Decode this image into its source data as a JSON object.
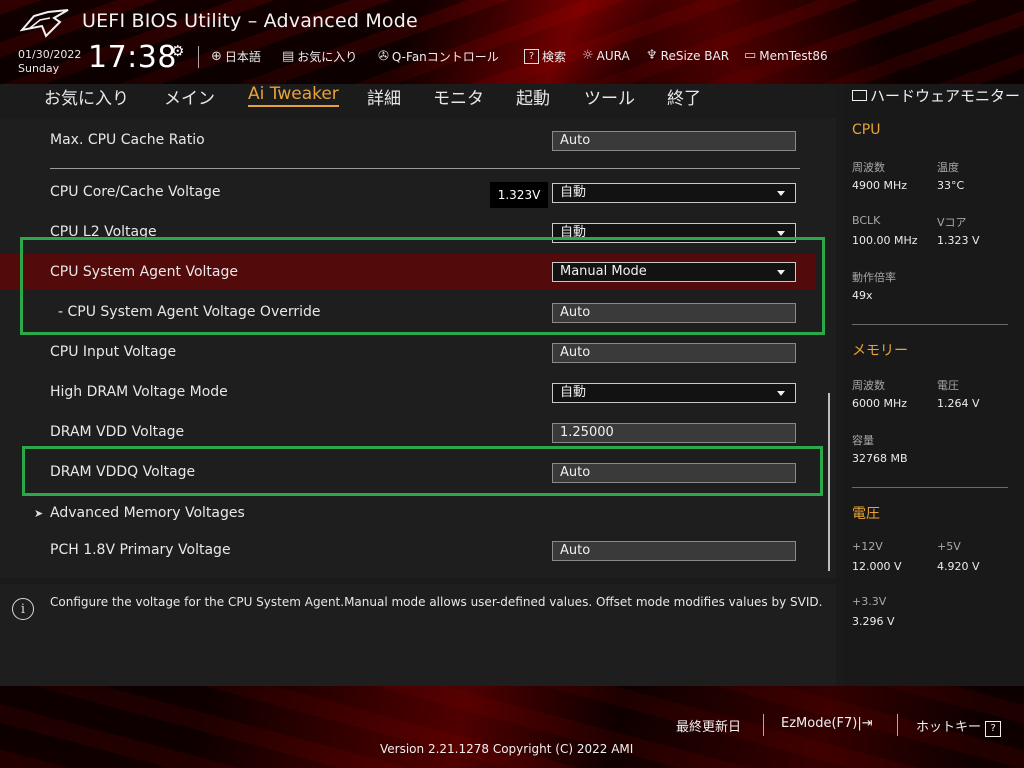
{
  "header": {
    "title": "UEFI BIOS Utility – Advanced Mode",
    "date": "01/30/2022",
    "day": "Sunday",
    "time": "17:38",
    "tools": [
      {
        "label": "日本語",
        "icon": "globe-icon"
      },
      {
        "label": "お気に入り",
        "icon": "favorites-icon"
      },
      {
        "label": "Q-Fanコントロール",
        "icon": "fan-icon"
      },
      {
        "label": "検索",
        "icon": "search-icon"
      },
      {
        "label": "AURA",
        "icon": "aura-icon"
      },
      {
        "label": "ReSize BAR",
        "icon": "resize-bar-icon"
      },
      {
        "label": "MemTest86",
        "icon": "memtest-icon"
      }
    ]
  },
  "menu": {
    "tabs": [
      {
        "label": "お気に入り",
        "active": false
      },
      {
        "label": "メイン",
        "active": false
      },
      {
        "label": "Ai Tweaker",
        "active": true
      },
      {
        "label": "詳細",
        "active": false
      },
      {
        "label": "モニタ",
        "active": false
      },
      {
        "label": "起動",
        "active": false
      },
      {
        "label": "ツール",
        "active": false
      },
      {
        "label": "終了",
        "active": false
      }
    ]
  },
  "settings": [
    {
      "label": "Max. CPU Cache Ratio",
      "value": "Auto",
      "type": "text"
    },
    {
      "label": "CPU Core/Cache Voltage",
      "value": "自動",
      "type": "dropdown",
      "readout": "1.323V"
    },
    {
      "label": "CPU L2 Voltage",
      "value": "自動",
      "type": "dropdown"
    },
    {
      "label": "CPU System Agent Voltage",
      "value": "Manual Mode",
      "type": "dropdown",
      "selected": true
    },
    {
      "label": "- CPU System Agent Voltage Override",
      "value": "Auto",
      "type": "text",
      "sub": true
    },
    {
      "label": "CPU Input Voltage",
      "value": "Auto",
      "type": "text"
    },
    {
      "label": "High DRAM Voltage Mode",
      "value": "自動",
      "type": "dropdown"
    },
    {
      "label": "DRAM VDD Voltage",
      "value": "1.25000",
      "type": "text"
    },
    {
      "label": "DRAM VDDQ Voltage",
      "value": "Auto",
      "type": "text"
    },
    {
      "label": "Advanced Memory Voltages",
      "type": "submenu"
    },
    {
      "label": "PCH 1.8V Primary Voltage",
      "value": "Auto",
      "type": "text"
    }
  ],
  "help": {
    "text": "Configure the voltage for the CPU System Agent.Manual mode allows user-defined values. Offset mode modifies values by SVID."
  },
  "monitor": {
    "title": "ハードウェアモニター",
    "cpu": {
      "heading": "CPU",
      "freq_label": "周波数",
      "freq": "4900 MHz",
      "temp_label": "温度",
      "temp": "33°C",
      "bclk_label": "BCLK",
      "bclk": "100.00 MHz",
      "vcore_label": "Vコア",
      "vcore": "1.323 V",
      "ratio_label": "動作倍率",
      "ratio": "49x"
    },
    "memory": {
      "heading": "メモリー",
      "freq_label": "周波数",
      "freq": "6000 MHz",
      "volt_label": "電圧",
      "volt": "1.264 V",
      "cap_label": "容量",
      "cap": "32768 MB"
    },
    "voltage": {
      "heading": "電圧",
      "v12_label": "+12V",
      "v12": "12.000 V",
      "v5_label": "+5V",
      "v5": "4.920 V",
      "v33_label": "+3.3V",
      "v33": "3.296 V"
    }
  },
  "footer": {
    "last_modified": "最終更新日",
    "ezmode": "EzMode(F7)",
    "hotkeys": "ホットキー",
    "version": "Version 2.21.1278 Copyright (C) 2022 AMI"
  },
  "colors": {
    "accent": "#e8a33a",
    "highlight_box": "#2aa84a",
    "selected_row": "#530a0a"
  }
}
